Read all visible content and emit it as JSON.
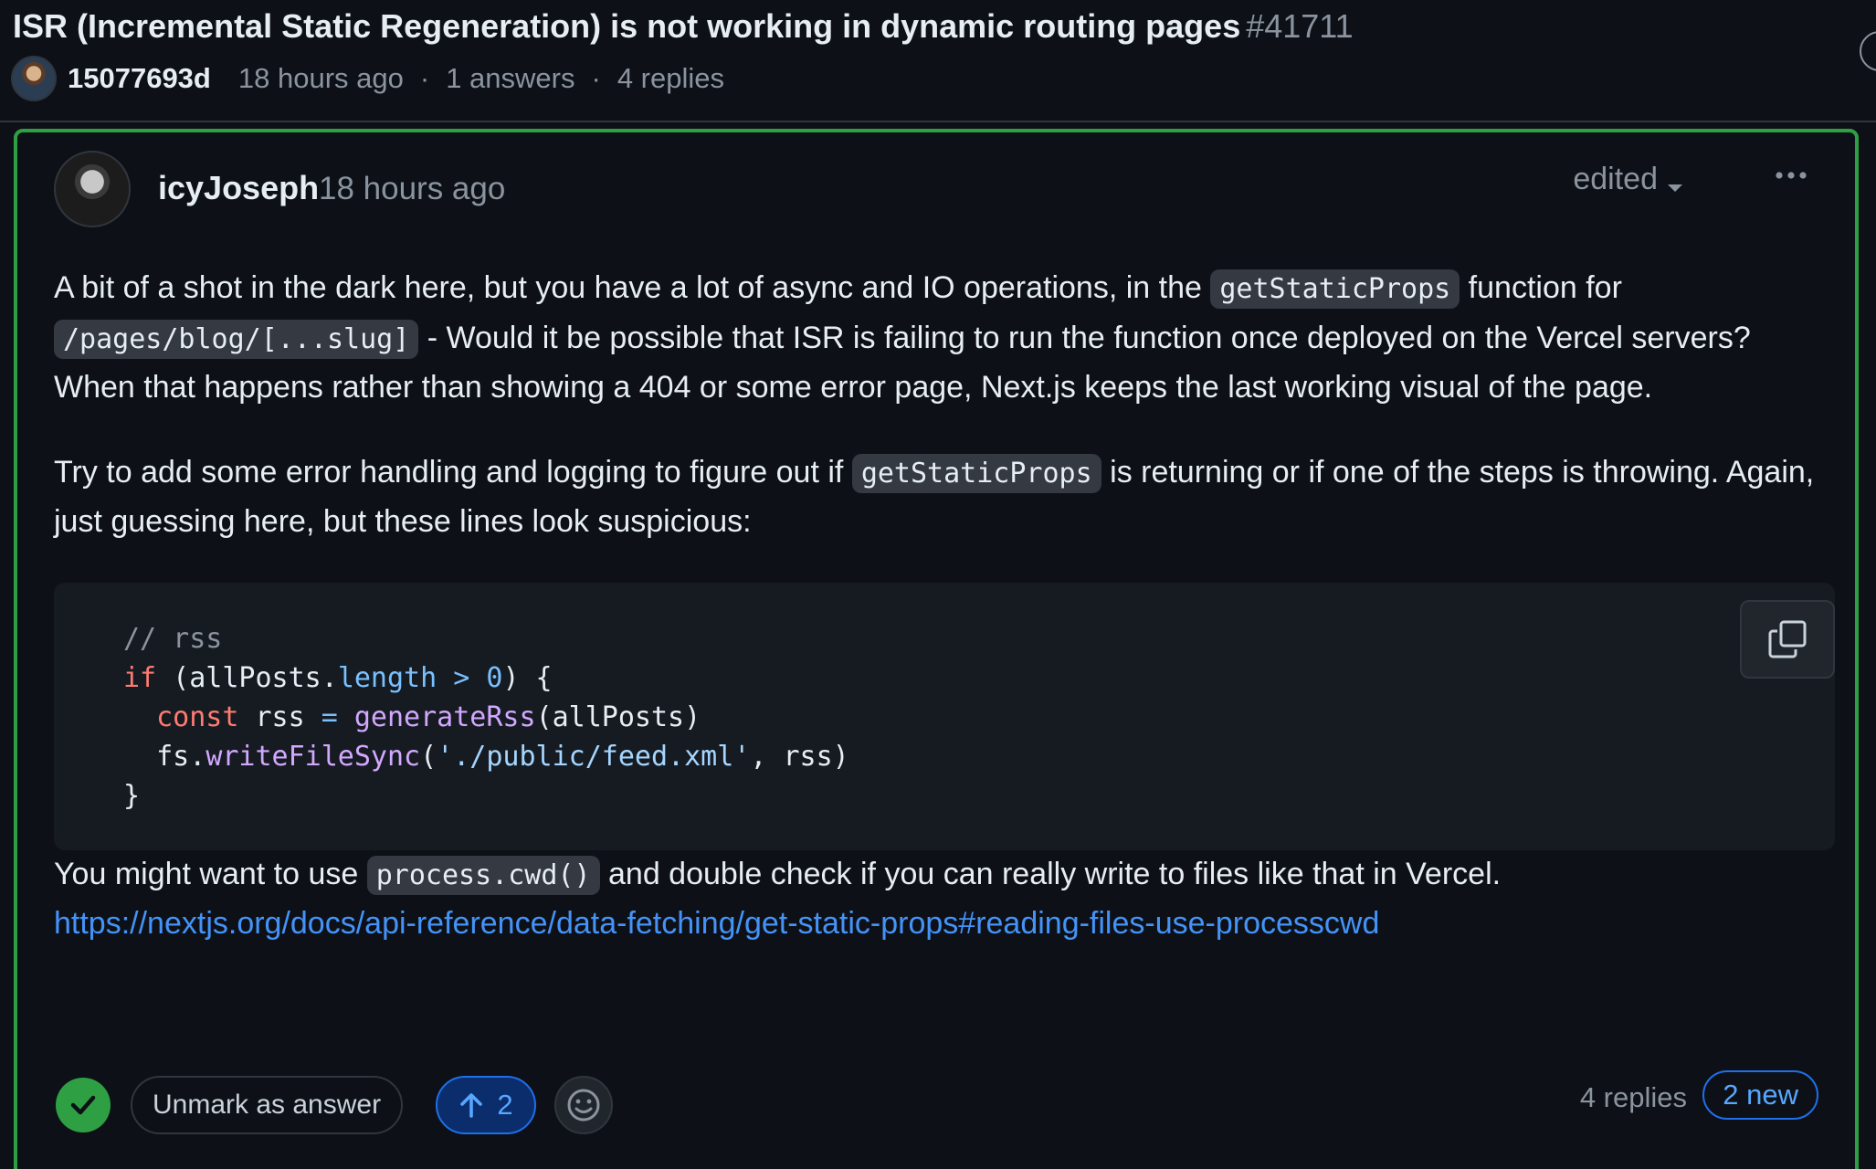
{
  "discussion": {
    "title": "ISR (Incremental Static Regeneration) is not working in dynamic routing pages",
    "number": "#41711",
    "author": "15077693d",
    "time": "18 hours ago",
    "answers": "1 answers",
    "replies": "4 replies",
    "separator": "·"
  },
  "answer": {
    "author": "icyJoseph",
    "time": "18 hours ago",
    "edited_label": "edited",
    "paragraph1": {
      "t1": "A bit of a shot in the dark here, but you have a lot of async and IO operations, in the ",
      "code1": "getStaticProps",
      "t2": " function for ",
      "code2": "/pages/blog/[...slug]",
      "t3": " - Would it be possible that ISR is failing to run the function once deployed on the Vercel servers? When that happens rather than showing a 404 or some error page, Next.js keeps the last working visual of the page."
    },
    "paragraph2": {
      "t1": "Try to add some error handling and logging to figure out if ",
      "code1": "getStaticProps",
      "t2": " is returning or if one of the steps is throwing. Again, just guessing here, but these lines look suspicious:"
    },
    "code": {
      "line1": "// rss",
      "line2": {
        "kw": "if",
        "a": " (allPosts.",
        "prop": "length",
        "op": " > ",
        "num": "0",
        "b": ") {"
      },
      "line3": {
        "indent": "  ",
        "kw": "const",
        "a": " rss ",
        "op": "=",
        "sp": " ",
        "fn": "generateRss",
        "b": "(allPosts)"
      },
      "line4": {
        "indent": "  ",
        "a": "fs.",
        "fn": "writeFileSync",
        "b": "(",
        "str": "'./public/feed.xml'",
        "c": ", rss)"
      },
      "line5": "}"
    },
    "paragraph3": {
      "t1": "You might want to use ",
      "code1": "process.cwd()",
      "t2": " and double check if you can really write to files like that in Vercel.",
      "link": "https://nextjs.org/docs/api-reference/data-fetching/get-static-props#reading-files-use-processcwd"
    },
    "footer": {
      "unmark_label": "Unmark as answer",
      "upvote_count": "2",
      "replies": "4 replies",
      "new_badge": "2 new"
    }
  },
  "colors": {
    "background": "#0d1117",
    "answer_border": "#2ea043",
    "link": "#4493f8",
    "muted": "#8b949e"
  },
  "icons": [
    "avatar",
    "caret-down-icon",
    "kebab-icon",
    "copy-icon",
    "check-icon",
    "arrow-up-icon",
    "smiley-icon"
  ]
}
